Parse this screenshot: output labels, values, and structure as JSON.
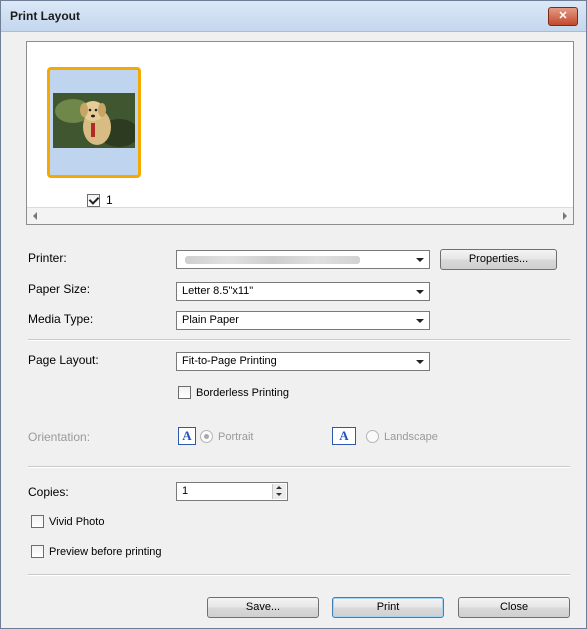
{
  "window": {
    "title": "Print Layout",
    "close_glyph": "✕"
  },
  "preview": {
    "page_checked": true,
    "page_number": "1"
  },
  "printer": {
    "label": "Printer:",
    "value_blurred": true,
    "properties_button": "Properties..."
  },
  "paper_size": {
    "label": "Paper Size:",
    "value": "Letter 8.5\"x11\""
  },
  "media_type": {
    "label": "Media Type:",
    "value": "Plain Paper"
  },
  "page_layout": {
    "label": "Page Layout:",
    "value": "Fit-to-Page Printing",
    "borderless_label": "Borderless Printing",
    "borderless_checked": false
  },
  "orientation": {
    "label": "Orientation:",
    "icon_letter": "A",
    "portrait_label": "Portrait",
    "landscape_label": "Landscape",
    "selected": "portrait",
    "enabled": false
  },
  "copies": {
    "label": "Copies:",
    "value": "1"
  },
  "options": {
    "vivid_photo_label": "Vivid Photo",
    "vivid_photo_checked": false,
    "preview_label": "Preview before printing",
    "preview_checked": false
  },
  "buttons": {
    "save": "Save...",
    "print": "Print",
    "close": "Close"
  }
}
